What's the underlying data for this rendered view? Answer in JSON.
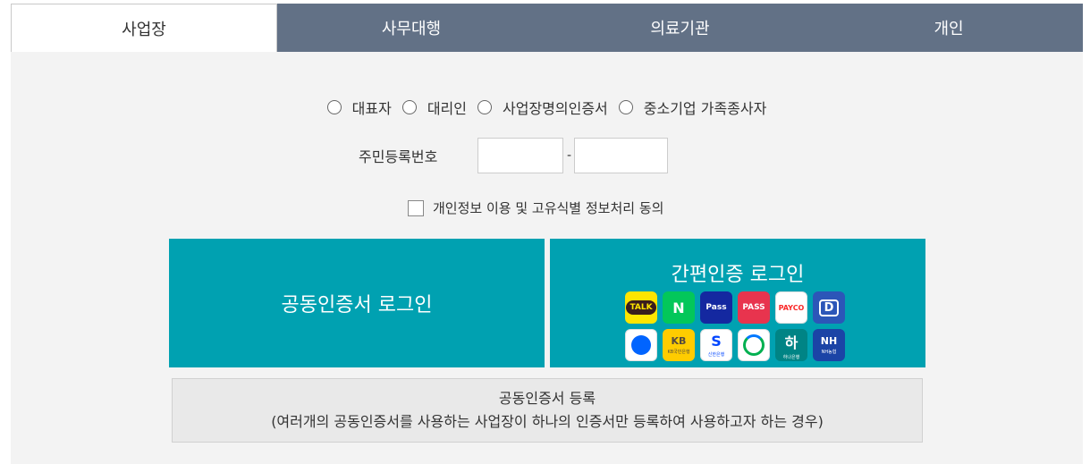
{
  "tabs": [
    {
      "label": "사업장",
      "active": true
    },
    {
      "label": "사무대행",
      "active": false
    },
    {
      "label": "의료기관",
      "active": false
    },
    {
      "label": "개인",
      "active": false
    }
  ],
  "role_options": [
    "대표자",
    "대리인",
    "사업장명의인증서",
    "중소기업 가족종사자"
  ],
  "rrn": {
    "label": "주민등록번호",
    "separator": "-",
    "front_value": "",
    "back_value": ""
  },
  "consent": {
    "label": "개인정보 이용 및 고유식별 정보처리 동의",
    "checked": false
  },
  "cert_login": {
    "label": "공동인증서 로그인"
  },
  "simple_login": {
    "label": "간편인증 로그인",
    "providers_row1": [
      {
        "name": "kakao-talk",
        "text": "TALK",
        "bg": "#fee500",
        "fg": "#3a1d1d"
      },
      {
        "name": "naver",
        "text": "N",
        "bg": "#03c75a",
        "fg": "#ffffff"
      },
      {
        "name": "samsung-pass",
        "text": "Pass",
        "bg": "#1428a0",
        "fg": "#ffffff"
      },
      {
        "name": "pass",
        "text": "PASS",
        "bg": "#e8344e",
        "fg": "#ffffff"
      },
      {
        "name": "payco",
        "text": "PAYCO",
        "bg": "#ffffff",
        "fg": "#fa2828"
      },
      {
        "name": "digital-one-pass",
        "text": "D",
        "bg": "#2c56b8",
        "fg": "#ffffff"
      }
    ],
    "providers_row2": [
      {
        "name": "toss",
        "text": "",
        "bg": "#ffffff",
        "fg": "#0064ff"
      },
      {
        "name": "kb-bank",
        "text": "KB",
        "sub": "KB국민은행",
        "bg": "#ffcc00",
        "fg": "#544a3f"
      },
      {
        "name": "shinhan-bank",
        "text": "S",
        "sub": "신한은행",
        "bg": "#ffffff",
        "fg": "#0046ff"
      },
      {
        "name": "woori-bank",
        "text": "",
        "bg": "#ffffff",
        "fg": "#00b050"
      },
      {
        "name": "hana-bank",
        "text": "하",
        "sub": "하나은행",
        "bg": "#008485",
        "fg": "#ffffff"
      },
      {
        "name": "nh-bank",
        "text": "NH",
        "sub": "NH농협",
        "bg": "#1b44a6",
        "fg": "#ffffff"
      }
    ]
  },
  "register": {
    "line1": "공동인증서 등록",
    "line2": "(여러개의 공동인증서를 사용하는 사업장이 하나의 인증서만 등록하여 사용하고자 하는 경우)"
  }
}
